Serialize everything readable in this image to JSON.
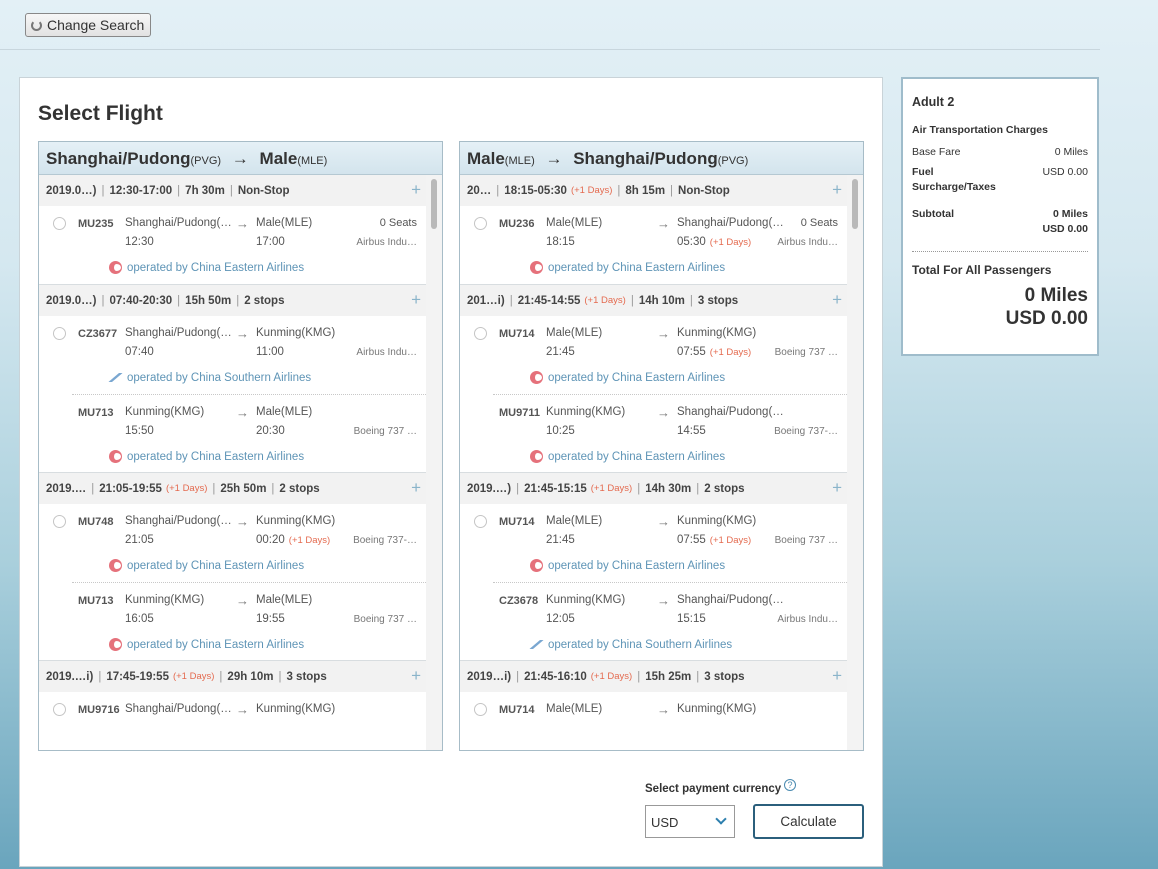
{
  "topbar": {
    "change_search_label": "Change Search"
  },
  "main": {
    "title": "Select Flight"
  },
  "outbound": {
    "from_city": "Shanghai/Pudong",
    "from_code": "(PVG)",
    "to_city": "Male",
    "to_code": "(MLE)",
    "groups": [
      {
        "date": "2019.0…)",
        "times": "12:30-17:00",
        "plus_days": "",
        "duration": "7h 30m",
        "stops": "Non-Stop",
        "segments": [
          {
            "flight": "MU235",
            "dep_city": "Shanghai/Pudong(…",
            "dep_time": "12:30",
            "arr_city": "Male(MLE)",
            "arr_time": "17:00",
            "arr_plus": "",
            "seats": "0 Seats",
            "aircraft": "Airbus Indu…",
            "operator": "operated by China Eastern Airlines",
            "logo": "china-eastern-logo-icon"
          }
        ]
      },
      {
        "date": "2019.0…)",
        "times": "07:40-20:30",
        "plus_days": "",
        "duration": "15h 50m",
        "stops": "2 stops",
        "segments": [
          {
            "flight": "CZ3677",
            "dep_city": "Shanghai/Pudong(…",
            "dep_time": "07:40",
            "arr_city": "Kunming(KMG)",
            "arr_time": "11:00",
            "arr_plus": "",
            "seats": "",
            "aircraft": "Airbus Indu…",
            "operator": "operated by China Southern Airlines",
            "logo": "china-southern-logo-icon"
          },
          {
            "flight": "MU713",
            "dep_city": "Kunming(KMG)",
            "dep_time": "15:50",
            "arr_city": "Male(MLE)",
            "arr_time": "20:30",
            "arr_plus": "",
            "seats": "",
            "aircraft": "Boeing 737 …",
            "operator": "operated by China Eastern Airlines",
            "logo": "china-eastern-logo-icon"
          }
        ]
      },
      {
        "date": "2019.…",
        "times": "21:05-19:55",
        "plus_days": "(+1 Days)",
        "duration": "25h 50m",
        "stops": "2 stops",
        "segments": [
          {
            "flight": "MU748",
            "dep_city": "Shanghai/Pudong(…",
            "dep_time": "21:05",
            "arr_city": "Kunming(KMG)",
            "arr_time": "00:20",
            "arr_plus": "(+1 Days)",
            "seats": "",
            "aircraft": "Boeing 737-…",
            "operator": "operated by China Eastern Airlines",
            "logo": "china-eastern-logo-icon"
          },
          {
            "flight": "MU713",
            "dep_city": "Kunming(KMG)",
            "dep_time": "16:05",
            "arr_city": "Male(MLE)",
            "arr_time": "19:55",
            "arr_plus": "",
            "seats": "",
            "aircraft": "Boeing 737 …",
            "operator": "operated by China Eastern Airlines",
            "logo": "china-eastern-logo-icon"
          }
        ]
      },
      {
        "date": "2019.…i)",
        "times": "17:45-19:55",
        "plus_days": "(+1 Days)",
        "duration": "29h 10m",
        "stops": "3 stops",
        "segments": [
          {
            "flight": "MU9716",
            "dep_city": "Shanghai/Pudong(…",
            "dep_time": "",
            "arr_city": "Kunming(KMG)",
            "arr_time": "",
            "arr_plus": "",
            "seats": "",
            "aircraft": "",
            "operator": "",
            "logo": ""
          }
        ]
      }
    ]
  },
  "inbound": {
    "from_city": "Male",
    "from_code": "(MLE)",
    "to_city": "Shanghai/Pudong",
    "to_code": "(PVG)",
    "groups": [
      {
        "date": "20…",
        "times": "18:15-05:30",
        "plus_days": "(+1 Days)",
        "duration": "8h 15m",
        "stops": "Non-Stop",
        "segments": [
          {
            "flight": "MU236",
            "dep_city": "Male(MLE)",
            "dep_time": "18:15",
            "arr_city": "Shanghai/Pudong(…",
            "arr_time": "05:30",
            "arr_plus": "(+1 Days)",
            "seats": "0 Seats",
            "aircraft": "Airbus Indu…",
            "operator": "operated by China Eastern Airlines",
            "logo": "china-eastern-logo-icon"
          }
        ]
      },
      {
        "date": "201…i)",
        "times": "21:45-14:55",
        "plus_days": "(+1 Days)",
        "duration": "14h 10m",
        "stops": "3 stops",
        "segments": [
          {
            "flight": "MU714",
            "dep_city": "Male(MLE)",
            "dep_time": "21:45",
            "arr_city": "Kunming(KMG)",
            "arr_time": "07:55",
            "arr_plus": "(+1 Days)",
            "seats": "",
            "aircraft": "Boeing 737 …",
            "operator": "operated by China Eastern Airlines",
            "logo": "china-eastern-logo-icon"
          },
          {
            "flight": "MU9711",
            "dep_city": "Kunming(KMG)",
            "dep_time": "10:25",
            "arr_city": "Shanghai/Pudong(…",
            "arr_time": "14:55",
            "arr_plus": "",
            "seats": "",
            "aircraft": "Boeing 737-…",
            "operator": "operated by China Eastern Airlines",
            "logo": "china-eastern-logo-icon"
          }
        ]
      },
      {
        "date": "2019.…)",
        "times": "21:45-15:15",
        "plus_days": "(+1 Days)",
        "duration": "14h 30m",
        "stops": "2 stops",
        "segments": [
          {
            "flight": "MU714",
            "dep_city": "Male(MLE)",
            "dep_time": "21:45",
            "arr_city": "Kunming(KMG)",
            "arr_time": "07:55",
            "arr_plus": "(+1 Days)",
            "seats": "",
            "aircraft": "Boeing 737 …",
            "operator": "operated by China Eastern Airlines",
            "logo": "china-eastern-logo-icon"
          },
          {
            "flight": "CZ3678",
            "dep_city": "Kunming(KMG)",
            "dep_time": "12:05",
            "arr_city": "Shanghai/Pudong(…",
            "arr_time": "15:15",
            "arr_plus": "",
            "seats": "",
            "aircraft": "Airbus Indu…",
            "operator": "operated by China Southern Airlines",
            "logo": "china-southern-logo-icon"
          }
        ]
      },
      {
        "date": "2019…i)",
        "times": "21:45-16:10",
        "plus_days": "(+1 Days)",
        "duration": "15h 25m",
        "stops": "3 stops",
        "segments": [
          {
            "flight": "MU714",
            "dep_city": "Male(MLE)",
            "dep_time": "",
            "arr_city": "Kunming(KMG)",
            "arr_time": "",
            "arr_plus": "",
            "seats": "",
            "aircraft": "",
            "operator": "",
            "logo": ""
          }
        ]
      }
    ]
  },
  "payment": {
    "label": "Select payment currency",
    "help": "?",
    "currency": "USD",
    "calculate_label": "Calculate"
  },
  "summary": {
    "passengers": "Adult 2",
    "section": "Air Transportation Charges",
    "base_fare_label": "Base Fare",
    "base_fare_value": "0 Miles",
    "fuel_label_1": "Fuel",
    "fuel_label_2": "Surcharge/Taxes",
    "fuel_value": "USD 0.00",
    "subtotal_label": "Subtotal",
    "subtotal_miles": "0 Miles",
    "subtotal_usd": "USD 0.00",
    "total_label": "Total For All Passengers",
    "total_miles": "0 Miles",
    "total_usd": "USD 0.00"
  }
}
